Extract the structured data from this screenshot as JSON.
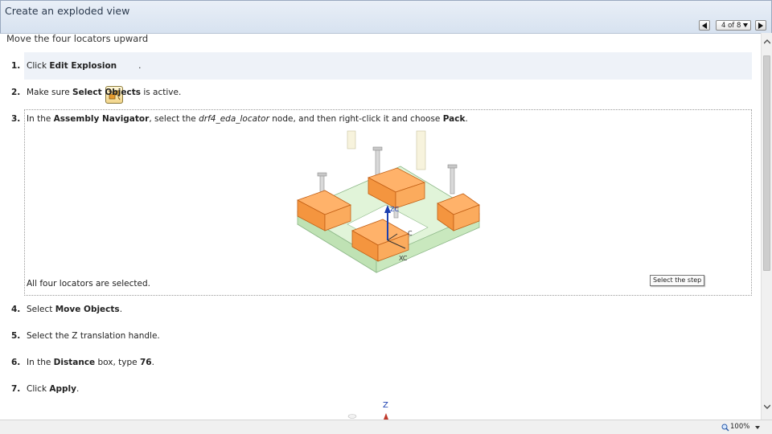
{
  "window": {
    "title": "Create an exploded view"
  },
  "nav": {
    "page_indicator": "4 of 8"
  },
  "content": {
    "heading": "Move the four locators upward",
    "steps": [
      {
        "num": "1.",
        "pre": "Click ",
        "bold": "Edit Explosion",
        "post": "."
      },
      {
        "num": "2.",
        "pre": "Make sure ",
        "bold": "Select Objects",
        "post": " is active."
      },
      {
        "num": "3.",
        "pre": "In the ",
        "bold": "Assembly Navigator",
        "mid": ", select the ",
        "italic": "drf4_eda_locator",
        "mid2": " node, and then right-click it and choose ",
        "bold2": "Pack",
        "post": "."
      },
      {
        "num": "4.",
        "pre": "Select ",
        "bold": "Move Objects",
        "post": "."
      },
      {
        "num": "5.",
        "pre": "Select the Z translation handle.",
        "bold": "",
        "post": ""
      },
      {
        "num": "6.",
        "pre": "In the ",
        "bold": "Distance",
        "mid": " box, type ",
        "bold2": "76",
        "post": "."
      },
      {
        "num": "7.",
        "pre": "Click ",
        "bold": "Apply",
        "post": "."
      }
    ],
    "step3_result": "All four locators are selected.",
    "tooltip": "Select the step",
    "figure_labels": {
      "zc": "ZC",
      "xc": "XC",
      "yc": "C",
      "z": "Z"
    }
  },
  "statusbar": {
    "zoom": "100%"
  },
  "icons": [
    "prev-icon",
    "next-icon",
    "dropdown-caret-icon",
    "edit-explosion-icon",
    "zoom-icon",
    "scroll-up-icon",
    "scroll-down-icon"
  ]
}
